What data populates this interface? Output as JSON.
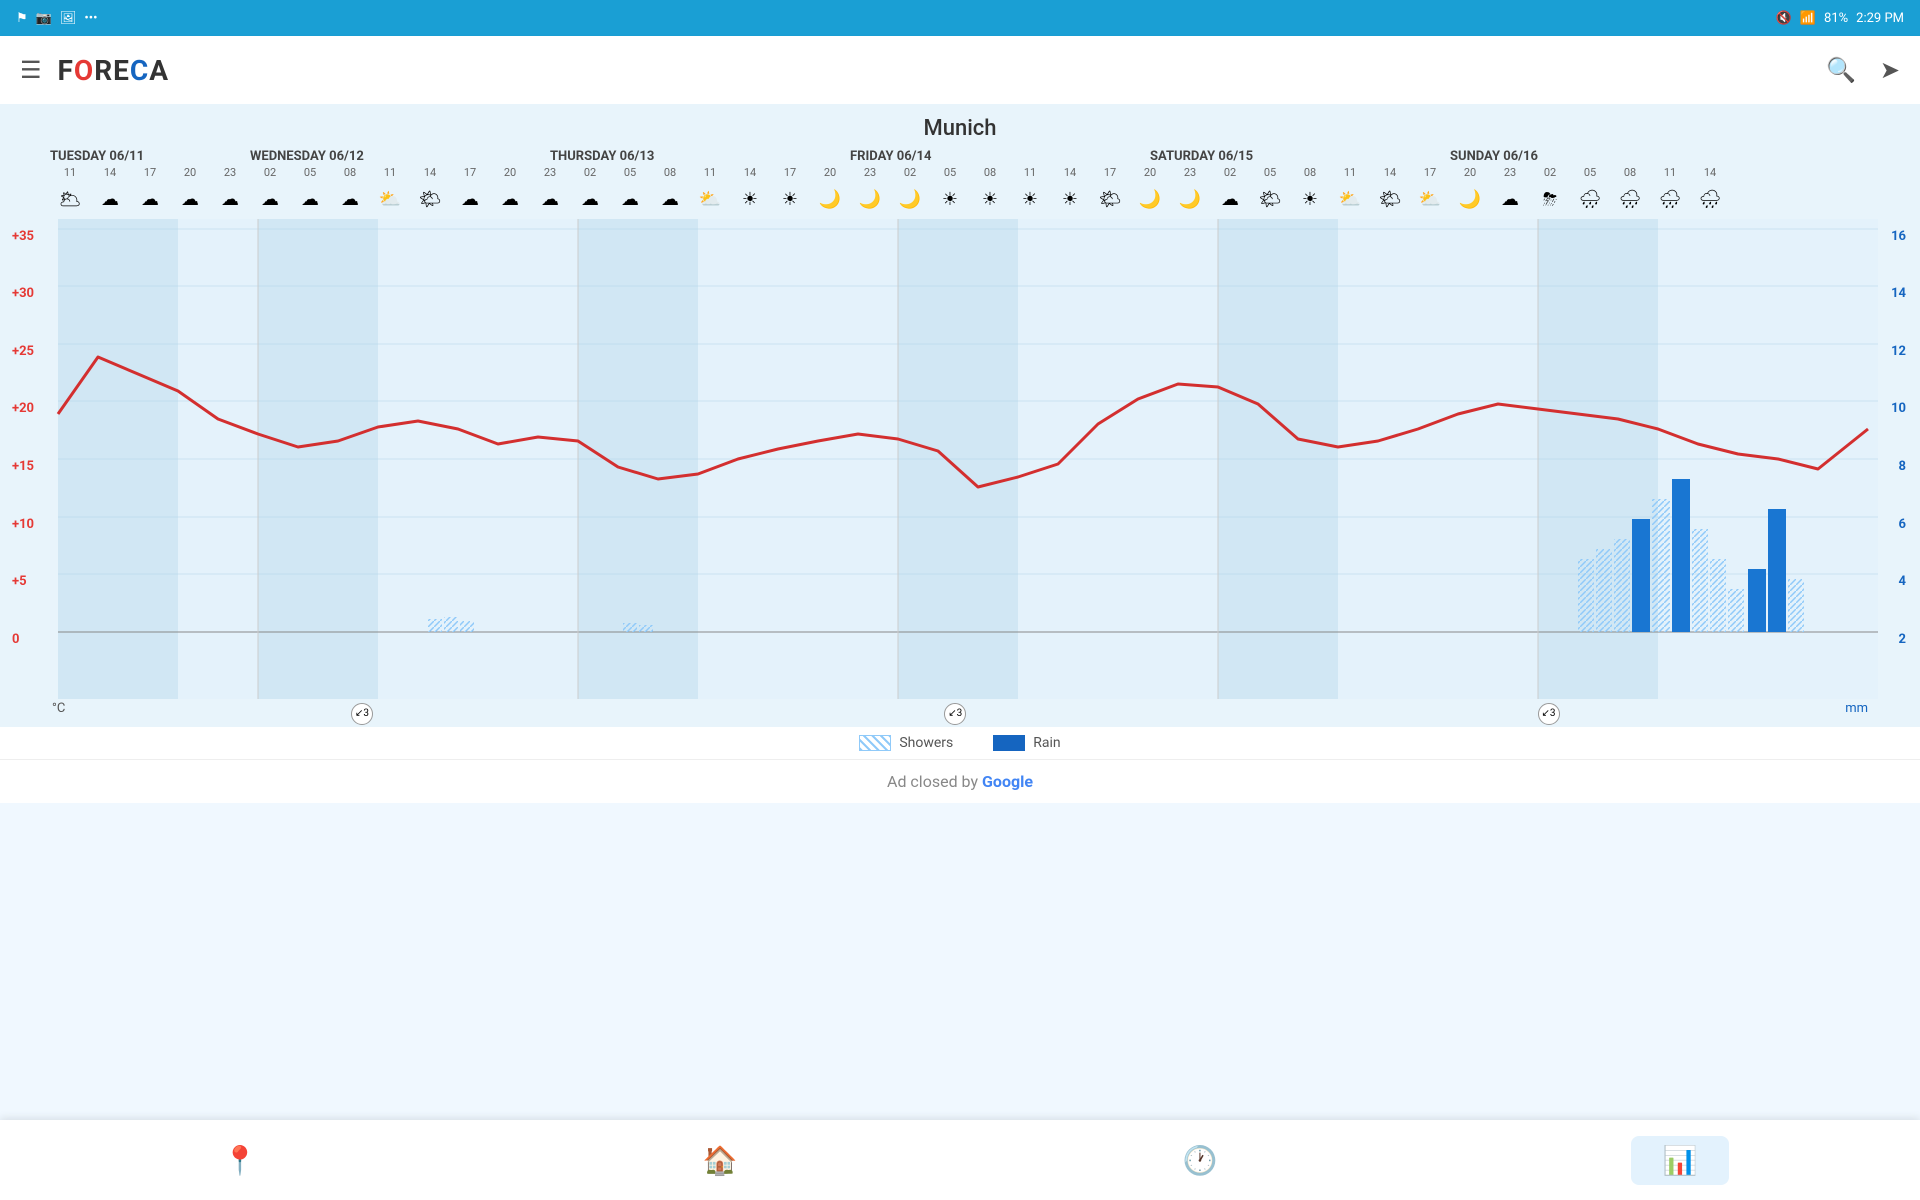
{
  "statusBar": {
    "battery": "81%",
    "time": "2:29 PM",
    "icons": [
      "notification-muted",
      "wifi",
      "battery"
    ]
  },
  "appBar": {
    "title": "FORECA",
    "menuIcon": "☰",
    "searchIcon": "🔍",
    "locationIcon": "➤"
  },
  "city": "Munich",
  "days": [
    {
      "label": "TUESDAY 06/11",
      "hours": [
        "11",
        "14",
        "17",
        "20",
        "23"
      ]
    },
    {
      "label": "WEDNESDAY 06/12",
      "hours": [
        "02",
        "05",
        "08",
        "11",
        "14",
        "17",
        "20",
        "23"
      ]
    },
    {
      "label": "THURSDAY 06/13",
      "hours": [
        "02",
        "05",
        "08",
        "11",
        "14",
        "17",
        "20",
        "23"
      ]
    },
    {
      "label": "FRIDAY 06/14",
      "hours": [
        "02",
        "05",
        "08",
        "11",
        "14",
        "17",
        "20",
        "23"
      ]
    },
    {
      "label": "SATURDAY 06/15",
      "hours": [
        "02",
        "05",
        "08",
        "11",
        "14",
        "17",
        "20",
        "23"
      ]
    },
    {
      "label": "SUNDAY 06/16",
      "hours": [
        "02",
        "05",
        "08",
        "11",
        "14"
      ]
    }
  ],
  "yAxisLeft": [
    "+35",
    "+30",
    "+25",
    "+20",
    "+15",
    "+10",
    "+5",
    "0"
  ],
  "yAxisRight": [
    "16",
    "14",
    "12",
    "10",
    "8",
    "6",
    "4",
    "2"
  ],
  "legend": {
    "showers": "Showers",
    "rain": "Rain"
  },
  "adClosed": "Ad closed by Google",
  "bottomNav": {
    "items": [
      {
        "icon": "location",
        "label": ""
      },
      {
        "icon": "home",
        "label": ""
      },
      {
        "icon": "history",
        "label": ""
      },
      {
        "icon": "chart",
        "label": "",
        "active": true
      }
    ]
  }
}
